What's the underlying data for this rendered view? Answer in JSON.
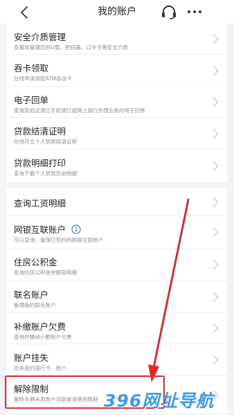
{
  "header": {
    "title": "我的账户",
    "back_icon": "chevron-left-icon",
    "service_icon": "headset-icon",
    "more_icon": "more-dots-icon"
  },
  "group1": [
    {
      "title": "安全介质管理",
      "sub": "查看和管理您的U盾、密码器、口令卡等安全介质"
    },
    {
      "title": "吞卡领取",
      "sub": "在线申请领取ATM吞没卡"
    },
    {
      "title": "电子回单",
      "sub": "查询及验证通过手机银行或网上银行办理业务的电子回单"
    },
    {
      "title": "贷款结清证明",
      "sub": "在线开立个人贷款结清证明"
    },
    {
      "title": "贷款明细打印",
      "sub": "查询下载个人贷款历史明细"
    }
  ],
  "group2": [
    {
      "title": "查询工资明细",
      "sub": ""
    },
    {
      "title": "网银互联账户",
      "sub": "可以查询、管理已签约的网银互联账户",
      "has_info": true
    },
    {
      "title": "住房公积金",
      "sub": "查询住房公积金余额及明细"
    },
    {
      "title": "联名账户",
      "sub": "管理我的联名账户"
    },
    {
      "title": "补缴账户欠费",
      "sub": "查询并缴纳小额账户欠费"
    },
    {
      "title": "账户挂失",
      "sub": "挂失我的银行卡、账户"
    },
    {
      "title": "解除限制",
      "sub": "解除长期未用账户自助渠道使用限制"
    }
  ],
  "watermark": "396网址导航",
  "colors": {
    "background": "#f2f3f5",
    "card": "#ffffff",
    "subtitle": "#8a8f98",
    "annotation_red": "#e02b2b",
    "info_blue": "#2f7fe0",
    "watermark_blue": "#2a90e8"
  }
}
